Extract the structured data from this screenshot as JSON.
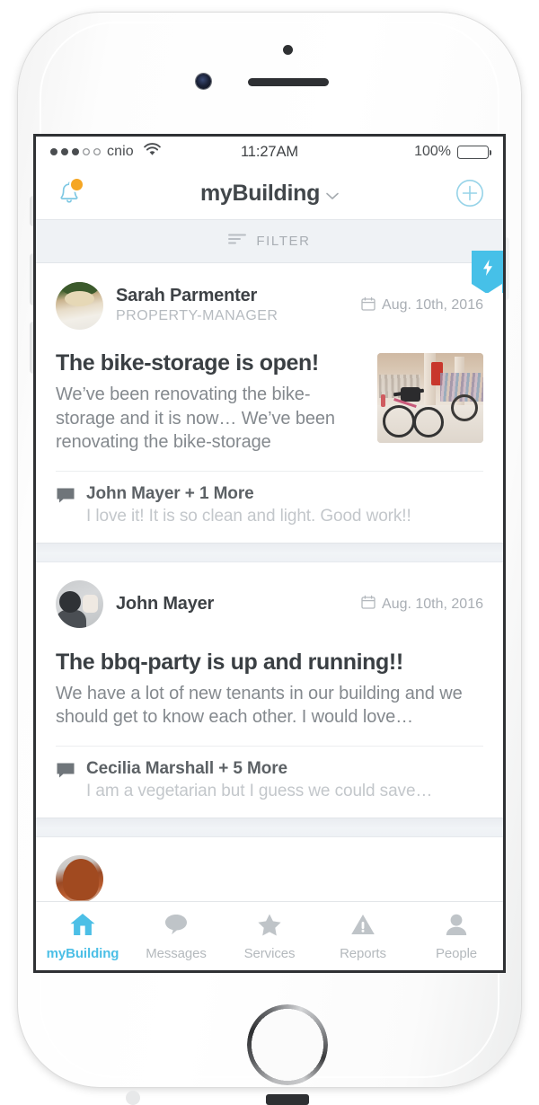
{
  "status_bar": {
    "carrier": "cnio",
    "signal_filled": 3,
    "signal_empty": 2,
    "wifi_icon": "wifi-icon",
    "time": "11:27AM",
    "battery_percent": "100%",
    "battery_level": 100
  },
  "nav": {
    "bell_icon": "bell-icon",
    "has_notification_badge": true,
    "title": "myBuilding",
    "chevron": "⌄",
    "add_icon": "plus-circle-icon"
  },
  "filter": {
    "icon": "filter-icon",
    "label": "FILTER"
  },
  "colors": {
    "accent_blue": "#4cbfe6",
    "ribbon_blue": "#46c0e8",
    "badge_orange": "#f5a623",
    "title_text": "#3a3f43",
    "body_text": "#84898e",
    "muted_text": "#b4b9bd",
    "separator_bg": "#eef1f5"
  },
  "posts": [
    {
      "author": "Sarah Parmenter",
      "role": "PROPERTY-MANAGER",
      "date": "Aug. 10th, 2016",
      "date_icon": "calendar-icon",
      "pinned": true,
      "pin_icon": "lightning-bolt-icon",
      "title": "The bike-storage is open!",
      "body": "We’ve been renovating the bike-storage and it is now… We’ve been renovating the bike-storage",
      "has_image": true,
      "image_alt": "bike-storage-photo",
      "comment": {
        "icon": "comment-bubble-icon",
        "author": "John Mayer + 1 More",
        "preview": "I love it! It is so clean and light. Good work!!"
      }
    },
    {
      "author": "John Mayer",
      "role": "",
      "date": "Aug. 10th, 2016",
      "date_icon": "calendar-icon",
      "pinned": false,
      "title": "The bbq-party is up and running!!",
      "body": "We have a lot of new tenants in our building and we should get to know each other. I would love…",
      "has_image": false,
      "comment": {
        "icon": "comment-bubble-icon",
        "author": "Cecilia Marshall + 5 More",
        "preview": "I am a vegetarian but I guess we could save…"
      }
    },
    {
      "author": "",
      "role": "",
      "date": "",
      "pinned": false,
      "title": "",
      "body": "",
      "has_image": false,
      "partial": true
    }
  ],
  "tabs": [
    {
      "label": "myBuilding",
      "icon": "home-icon",
      "active": true
    },
    {
      "label": "Messages",
      "icon": "chat-bubble-icon",
      "active": false
    },
    {
      "label": "Services",
      "icon": "star-icon",
      "active": false
    },
    {
      "label": "Reports",
      "icon": "warning-triangle-icon",
      "active": false
    },
    {
      "label": "People",
      "icon": "person-icon",
      "active": false
    }
  ]
}
